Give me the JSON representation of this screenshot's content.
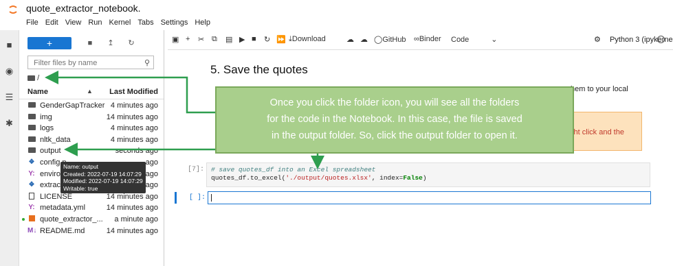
{
  "app": {
    "notebook_title": "quote_extractor_notebook.",
    "menu": [
      "File",
      "Edit",
      "View",
      "Run",
      "Kernel",
      "Tabs",
      "Settings",
      "Help"
    ]
  },
  "browser": {
    "new_label": "+",
    "filter_placeholder": "Filter files by name",
    "breadcrumb": "/",
    "col_name": "Name",
    "col_modified": "Last Modified",
    "files": [
      {
        "name": "GenderGapTracker",
        "modified": "4 minutes ago",
        "kind": "folder"
      },
      {
        "name": "img",
        "modified": "14 minutes ago",
        "kind": "folder"
      },
      {
        "name": "logs",
        "modified": "4 minutes ago",
        "kind": "folder"
      },
      {
        "name": "nltk_data",
        "modified": "4 minutes ago",
        "kind": "folder"
      },
      {
        "name": "output",
        "modified": "seconds ago",
        "kind": "folder"
      },
      {
        "name": "config.p",
        "modified": "ago",
        "kind": "python"
      },
      {
        "name": "environ",
        "modified": "ago",
        "kind": "yaml"
      },
      {
        "name": "extract",
        "modified": "ago",
        "kind": "python"
      },
      {
        "name": "LICENSE",
        "modified": "14 minutes ago",
        "kind": "license"
      },
      {
        "name": "metadata.yml",
        "modified": "14 minutes ago",
        "kind": "yaml"
      },
      {
        "name": "quote_extractor_...",
        "modified": "a minute ago",
        "kind": "notebook"
      },
      {
        "name": "README.md",
        "modified": "14 minutes ago",
        "kind": "markdown"
      }
    ],
    "tooltip": [
      "Name: output",
      "Created: 2022-07-19 14:07:29",
      "Modified: 2022-07-19 14:07:29",
      "Writable: true"
    ]
  },
  "toolbar": {
    "download": "Download",
    "github": "GitHub",
    "binder": "Binder",
    "cell_type": "Code",
    "kernel": "Python 3 (ipykernel)"
  },
  "notebook": {
    "heading": "5. Save the quotes",
    "para_tail": "hem to your local",
    "orange_text": "ight click and the",
    "cell7_prompt": "[7]:",
    "cell7_line1": "# save quotes_df into an Excel spreadsheet",
    "cell7_line2_a": "quotes_df.to_excel(",
    "cell7_line2_str": "'./output/quotes.xlsx'",
    "cell7_line2_b": ", index=",
    "cell7_line2_kw": "False",
    "cell7_line2_c": ")",
    "empty_prompt": "[ ]:"
  },
  "callout": {
    "lines": [
      "Once you click the folder icon, you will see all the folders",
      "for the code in the Notebook. In this case, the file is saved",
      "in the output folder. So, click the output folder to open it."
    ]
  },
  "colors": {
    "accent": "#1976d2",
    "callout_fill": "#a9cf8c",
    "arrow": "#2e9e4f"
  }
}
